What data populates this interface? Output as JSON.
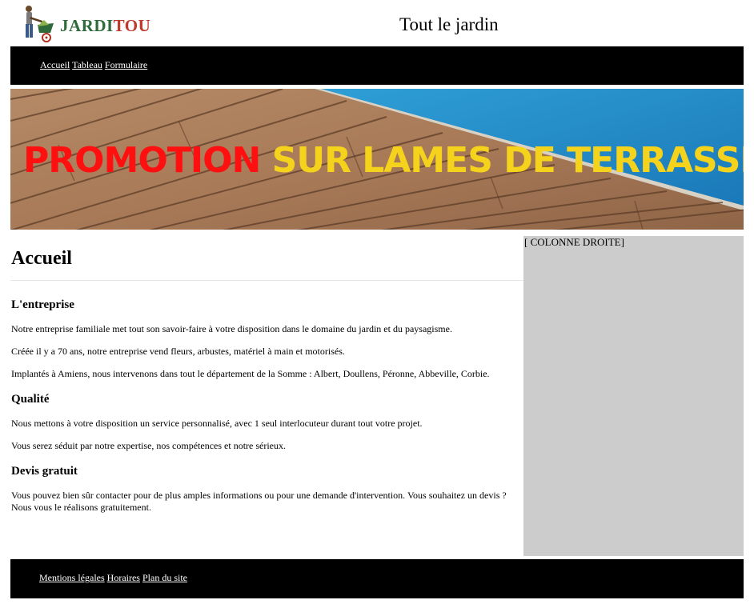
{
  "header": {
    "logo_text_part1": "JARDI",
    "logo_text_part2": "TOU",
    "site_title": "Tout le jardin"
  },
  "nav": {
    "links": [
      {
        "label": "Accueil"
      },
      {
        "label": "Tableau"
      },
      {
        "label": "Formulaire"
      }
    ]
  },
  "banner": {
    "text_part1": "PROMOTION",
    "text_part2": "SUR LAMES DE TERRASSE"
  },
  "main": {
    "title": "Accueil",
    "sections": [
      {
        "heading": "L'entreprise",
        "paragraphs": [
          "Notre entreprise familiale met tout son savoir-faire à votre disposition dans le domaine du jardin et du paysagisme.",
          "Créée il y a 70 ans, notre entreprise vend fleurs, arbustes, matériel à main et motorisés.",
          "Implantés à Amiens, nous intervenons dans tout le département de la Somme : Albert, Doullens, Péronne, Abbeville, Corbie."
        ]
      },
      {
        "heading": "Qualité",
        "paragraphs": [
          "Nous mettons à votre disposition un service personnalisé, avec 1 seul interlocuteur durant tout votre projet.",
          "Vous serez séduit par notre expertise, nos compétences et notre sérieux."
        ]
      },
      {
        "heading": "Devis gratuit",
        "paragraphs": [
          "Vous pouvez bien sûr contacter pour de plus amples informations ou pour une demande d'intervention. Vous souhaitez un devis ? Nous vous le réalisons gratuitement."
        ]
      }
    ]
  },
  "aside": {
    "label": "[ COLONNE DROITE]"
  },
  "footer": {
    "links": [
      {
        "label": "Mentions légales"
      },
      {
        "label": "Horaires"
      },
      {
        "label": "Plan du site"
      }
    ]
  },
  "colors": {
    "nav_bg": "#000000",
    "aside_bg": "#cccccc",
    "promo_red": "#ff1010",
    "promo_yellow": "#f5d31c",
    "logo_green": "#2f6b3a",
    "logo_red": "#c0392b"
  }
}
